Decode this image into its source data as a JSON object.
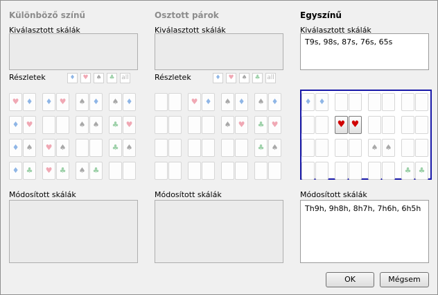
{
  "labels": {
    "selected_ranges": "Kiválasztott skálák",
    "details": "Részletek",
    "modified_ranges": "Módosított skálák"
  },
  "columns": [
    {
      "heading": "Különböző színű",
      "selected_value": "",
      "modified_value": ""
    },
    {
      "heading": "Osztott párok",
      "selected_value": "",
      "modified_value": ""
    },
    {
      "heading": "Egyszínű",
      "selected_value": "T9s, 98s, 87s, 76s, 65s",
      "modified_value": "Th9h, 9h8h, 8h7h, 7h6h, 6h5h"
    }
  ],
  "suit_buttons": [
    "diamond",
    "heart",
    "spade",
    "club",
    "all"
  ],
  "suit_all_label": "all",
  "suit_glyphs": {
    "diamond": "♦",
    "heart": "♥",
    "spade": "♠",
    "club": "♣"
  },
  "suit_colors": {
    "diamond": "#8fb6e6",
    "heart": "#f0a8b4",
    "spade": "#a8a8a8",
    "club": "#9cd0a8",
    "heart_active": "#d00000"
  },
  "grids": [
    [
      [
        [
          "heart",
          "diamond"
        ],
        [
          "diamond",
          "heart"
        ],
        [
          "spade",
          "diamond"
        ],
        [
          "spade",
          "diamond"
        ]
      ],
      [
        [
          "diamond",
          "heart"
        ],
        [
          "",
          ""
        ],
        [
          "spade",
          "spade"
        ],
        [
          "club",
          "heart"
        ]
      ],
      [
        [
          "diamond",
          "spade"
        ],
        [
          "heart",
          "spade"
        ],
        [
          "",
          ""
        ],
        [
          "club",
          "spade"
        ]
      ],
      [
        [
          "diamond",
          "club"
        ],
        [
          "heart",
          "club"
        ],
        [
          "spade",
          "club"
        ],
        [
          "",
          ""
        ]
      ]
    ],
    [
      [
        [
          "",
          ""
        ],
        [
          "heart",
          "diamond"
        ],
        [
          "spade",
          "diamond"
        ],
        [
          "spade",
          "diamond"
        ]
      ],
      [
        [
          "",
          ""
        ],
        [
          "",
          ""
        ],
        [
          "spade",
          "heart"
        ],
        [
          "club",
          "heart"
        ]
      ],
      [
        [
          "",
          ""
        ],
        [
          "",
          ""
        ],
        [
          "",
          ""
        ],
        [
          "club",
          "spade"
        ]
      ],
      [
        [
          "",
          ""
        ],
        [
          "",
          ""
        ],
        [
          "",
          ""
        ],
        [
          "",
          ""
        ]
      ]
    ],
    [
      [
        [
          "diamond",
          "diamond"
        ],
        [
          "",
          ""
        ],
        [
          "",
          ""
        ],
        [
          "",
          ""
        ]
      ],
      [
        [
          "",
          ""
        ],
        [
          "heart",
          "heart"
        ],
        [
          "",
          ""
        ],
        [
          "",
          ""
        ]
      ],
      [
        [
          "",
          ""
        ],
        [
          "",
          ""
        ],
        [
          "spade",
          "spade"
        ],
        [
          "",
          ""
        ]
      ],
      [
        [
          "",
          ""
        ],
        [
          "",
          ""
        ],
        [
          "",
          ""
        ],
        [
          "club",
          "club"
        ]
      ]
    ]
  ],
  "selected_pair": {
    "grid": 2,
    "row": 1,
    "col": 1
  },
  "buttons": {
    "ok": "OK",
    "cancel": "Mégsem"
  }
}
